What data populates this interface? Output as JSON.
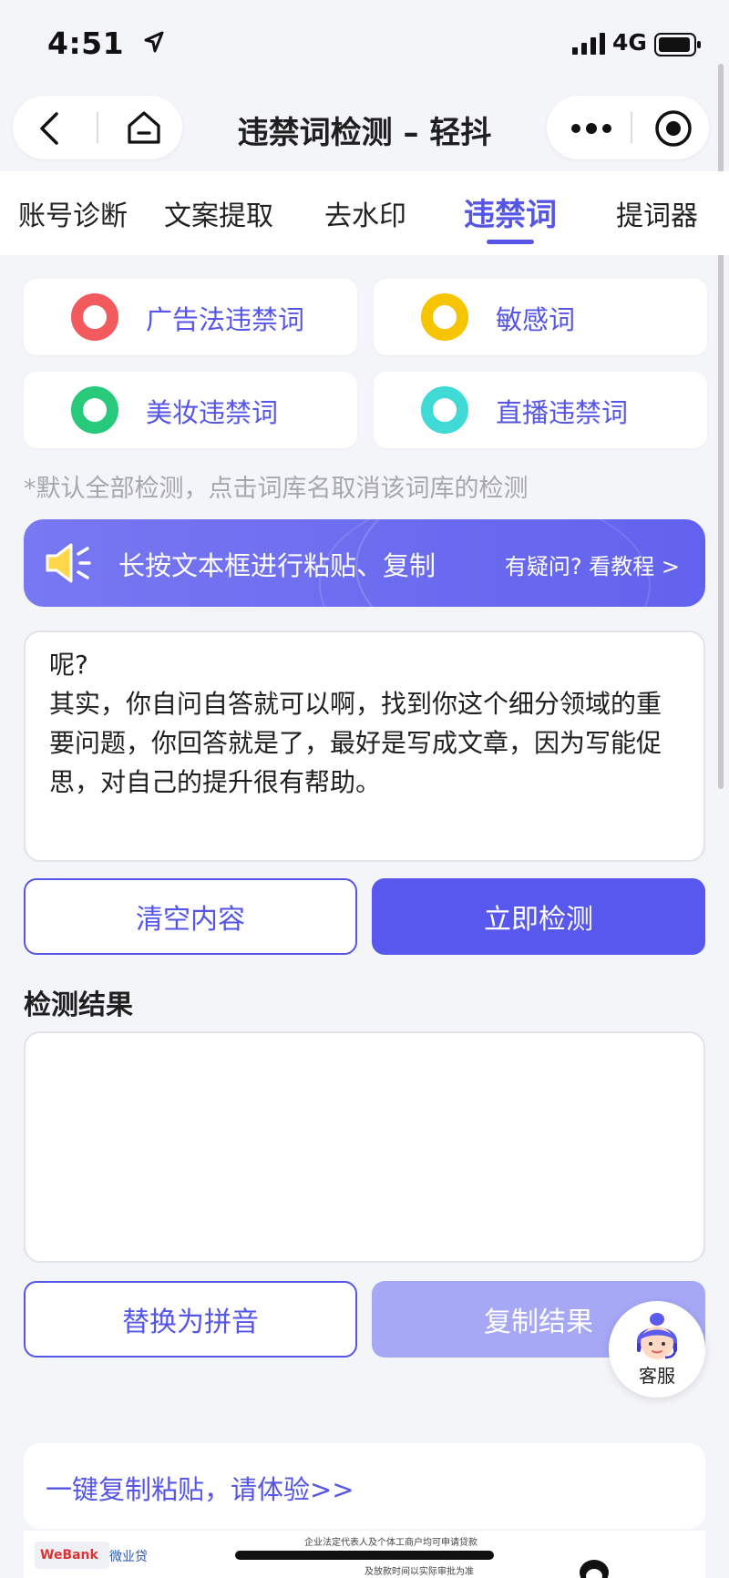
{
  "status_bar": {
    "time": "4:51",
    "network": "4G"
  },
  "nav": {
    "title": "违禁词检测 – 轻抖"
  },
  "tabs": [
    {
      "label": "账号诊断",
      "active": false
    },
    {
      "label": "文案提取",
      "active": false
    },
    {
      "label": "去水印",
      "active": false
    },
    {
      "label": "违禁词",
      "active": true
    },
    {
      "label": "提词器",
      "active": false
    }
  ],
  "libraries": [
    {
      "label": "广告法违禁词",
      "color": "#f25a5e"
    },
    {
      "label": "敏感词",
      "color": "#f7c500"
    },
    {
      "label": "美妆违禁词",
      "color": "#27c97b"
    },
    {
      "label": "直播违禁词",
      "color": "#3fd9d6"
    }
  ],
  "hint": "*默认全部检测，点击词库名取消该词库的检测",
  "banner": {
    "text": "长按文本框进行粘贴、复制",
    "link": "有疑问? 看教程 >"
  },
  "input": {
    "text": "呢?\n其实，你自问自答就可以啊，找到你这个细分领域的重要问题，你回答就是了，最好是写成文章，因为写能促思，对自己的提升很有帮助。"
  },
  "buttons": {
    "clear": "清空内容",
    "detect": "立即检测",
    "pinyin": "替换为拼音",
    "copy": "复制结果"
  },
  "result": {
    "title": "检测结果",
    "text": ""
  },
  "service": {
    "label": "客服"
  },
  "promo": {
    "text": "一键复制粘贴，请体验>>"
  },
  "ad": {
    "logo_text": "WeBank",
    "brand": "微业贷",
    "line1": "企业法定代表人及个体工商户均可申请贷款",
    "line2": "及放款时间以实际审批为准"
  },
  "colors": {
    "accent": "#5555e8",
    "accent_light": "#a6a8f6",
    "background": "#f4f5f9"
  }
}
